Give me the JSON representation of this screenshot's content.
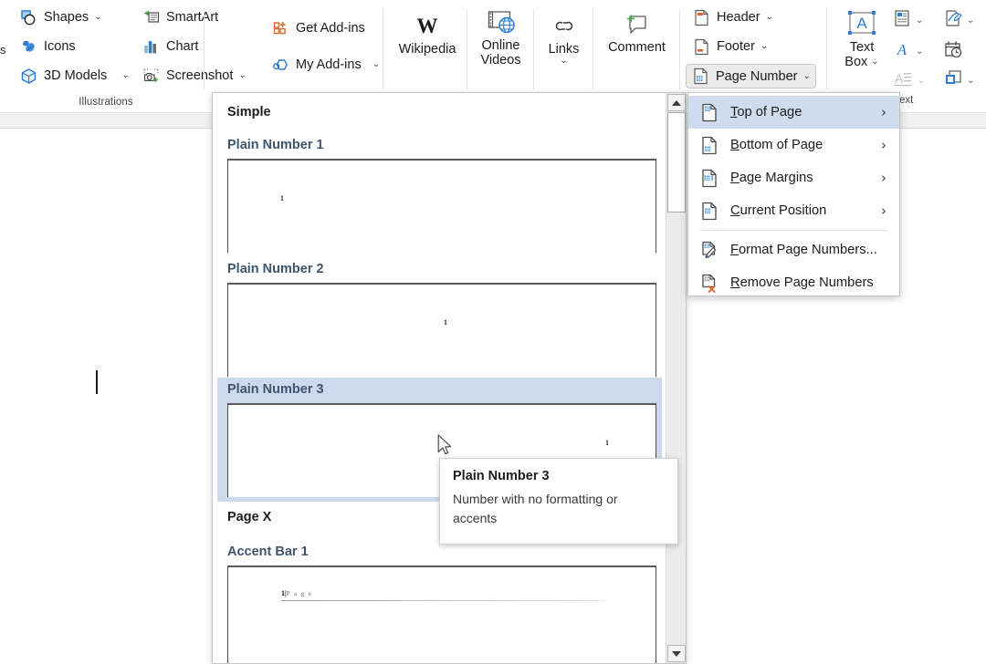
{
  "ribbon": {
    "edge_text": "s",
    "groups": [
      {
        "label": "Illustrations"
      }
    ],
    "illustrations": [
      {
        "label": "Shapes",
        "icon": "shapes-icon",
        "caret": "⌄"
      },
      {
        "label": "Icons",
        "icon": "icons-icon",
        "caret": ""
      },
      {
        "label": "3D Models",
        "icon": "3d-models-icon",
        "caret": "⌄"
      },
      {
        "label": "SmartArt",
        "icon": "smartart-icon",
        "caret": ""
      },
      {
        "label": "Chart",
        "icon": "chart-icon",
        "caret": ""
      },
      {
        "label": "Screenshot",
        "icon": "screenshot-icon",
        "caret": "⌄"
      }
    ],
    "addins": [
      {
        "label": "Get Add-ins",
        "icon": "get-addins-icon",
        "caret": ""
      },
      {
        "label": "My Add-ins",
        "icon": "my-addins-icon",
        "caret": "⌄"
      }
    ],
    "wikipedia": {
      "label": "Wikipedia",
      "icon": "wikipedia-icon"
    },
    "online_videos": {
      "label_line1": "Online",
      "label_line2": "Videos",
      "icon": "online-video-icon"
    },
    "links": {
      "label": "Links",
      "icon": "links-icon",
      "caret": "⌄"
    },
    "comment": {
      "label": "Comment",
      "icon": "comment-icon"
    },
    "header_footer": [
      {
        "label": "Header",
        "icon": "header-icon",
        "caret": "⌄",
        "selected": false
      },
      {
        "label": "Footer",
        "icon": "footer-icon",
        "caret": "⌄",
        "selected": false
      },
      {
        "label": "Page Number",
        "icon": "page-number-icon",
        "caret": "⌄",
        "selected": true
      }
    ],
    "text_group": {
      "label": "ext",
      "text_box": {
        "label_line1": "Text",
        "label_line2": "Box",
        "caret": "⌄",
        "icon": "text-box-icon"
      },
      "minis": [
        {
          "icon": "quick-parts-icon",
          "caret": "⌄"
        },
        {
          "icon": "wordart-icon",
          "caret": "⌄"
        },
        {
          "icon": "drop-cap-icon",
          "caret": "⌄"
        },
        {
          "icon": "signature-line-icon",
          "caret": "⌄"
        },
        {
          "icon": "date-time-icon",
          "caret": ""
        },
        {
          "icon": "object-icon",
          "caret": "⌄"
        }
      ]
    }
  },
  "gallery": {
    "category": "Simple",
    "items": [
      {
        "name": "Plain Number 1",
        "align": "left",
        "highlighted": false,
        "number": "1",
        "kind": "plain"
      },
      {
        "name": "Plain Number 2",
        "align": "center",
        "highlighted": false,
        "number": "1",
        "kind": "plain"
      },
      {
        "name": "Plain Number 3",
        "align": "right",
        "highlighted": true,
        "number": "1",
        "kind": "plain"
      }
    ],
    "category2": "Page X",
    "items2": [
      {
        "name": "Accent Bar 1",
        "align": "left",
        "highlighted": false,
        "number": "1",
        "separator": "|",
        "word": "P a g e",
        "kind": "accent"
      }
    ],
    "scrollbar": {
      "up_arrow": "▲",
      "down_arrow": "▼"
    }
  },
  "menu": {
    "items": [
      {
        "label": "Top of Page",
        "mnemonic": "T",
        "rest": "op of Page",
        "icon": "page-number-top-icon",
        "arrow": "›",
        "active": true,
        "divider_after": false
      },
      {
        "label": "Bottom of Page",
        "mnemonic": "B",
        "rest": "ottom of Page",
        "icon": "page-number-bottom-icon",
        "arrow": "›",
        "active": false,
        "divider_after": false
      },
      {
        "label": "Page Margins",
        "mnemonic": "P",
        "rest": "age Margins",
        "icon": "page-number-margins-icon",
        "arrow": "›",
        "active": false,
        "divider_after": false
      },
      {
        "label": "Current Position",
        "mnemonic": "C",
        "rest": "urrent Position",
        "icon": "page-number-current-icon",
        "arrow": "›",
        "active": false,
        "divider_after": true
      },
      {
        "label": "Format Page Numbers...",
        "mnemonic": "F",
        "rest": "ormat Page Numbers...",
        "icon": "format-page-numbers-icon",
        "arrow": "",
        "active": false,
        "divider_after": false
      },
      {
        "label": "Remove Page Numbers",
        "mnemonic": "R",
        "rest": "emove Page Numbers",
        "icon": "remove-page-numbers-icon",
        "arrow": "",
        "active": false,
        "divider_after": false
      }
    ]
  },
  "tooltip": {
    "title": "Plain Number 3",
    "description": "Number with no formatting or accents"
  },
  "colors": {
    "accent_blue": "#2b7cd3",
    "highlight": "#cdd9ec",
    "menu_active": "#cfdcf0",
    "heading_text": "#41546e",
    "orange": "#e8622c",
    "green": "#4ca64c"
  }
}
